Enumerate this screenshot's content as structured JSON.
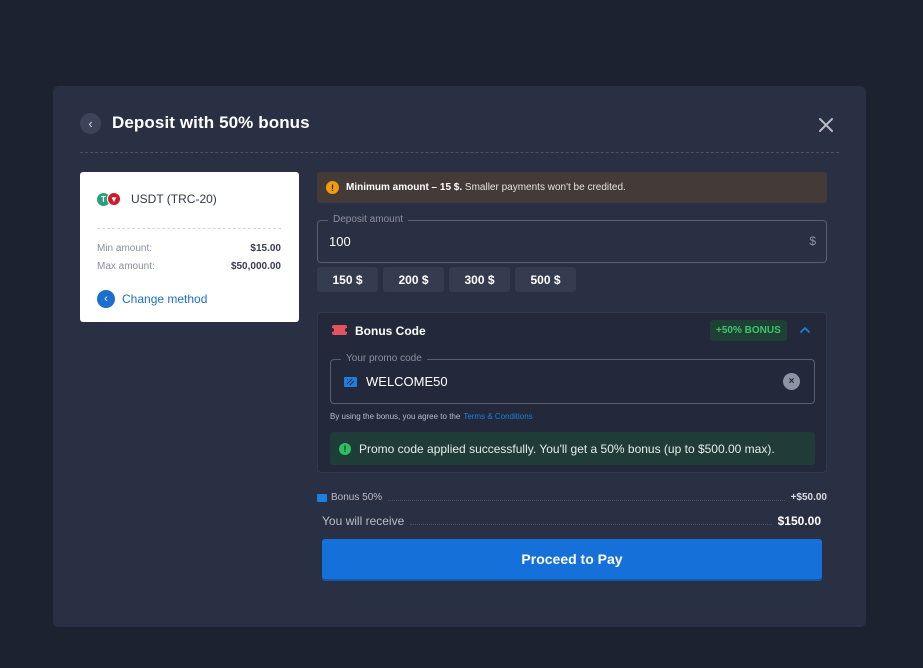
{
  "modal": {
    "title": "Deposit with 50% bonus",
    "back_icon": "chevron-left-icon",
    "close_icon": "close-icon"
  },
  "method": {
    "name": "USDT (TRC-20)",
    "coin_icons": [
      "usdt-icon",
      "tron-icon"
    ],
    "min_label": "Min amount:",
    "min_value": "$15.00",
    "max_label": "Max amount:",
    "max_value": "$50,000.00",
    "change_label": "Change method"
  },
  "warning": {
    "bold": "Minimum amount – 15 $.",
    "rest": " Smaller payments won't be credited."
  },
  "deposit": {
    "legend": "Deposit amount",
    "value": "100",
    "currency": "$",
    "quick_amounts": [
      "150 $",
      "200 $",
      "300 $",
      "500 $"
    ]
  },
  "bonus": {
    "title": "Bonus Code",
    "badge": "+50% BONUS",
    "promo_legend": "Your promo code",
    "promo_value": "WELCOME50",
    "terms_text": "By using the bonus, you agree to the",
    "terms_link": "Terms & Conditions",
    "success_text": "Promo code applied successfully. You'll get a 50% bonus (up to $500.00 max)."
  },
  "summary": {
    "bonus_label": "Bonus 50%",
    "bonus_value": "+$50.00",
    "receive_label": "You will receive",
    "receive_value": "$150.00"
  },
  "actions": {
    "proceed_label": "Proceed to Pay"
  },
  "colors": {
    "background": "#1d2231",
    "modal": "#2a3043",
    "accent": "#1670d9",
    "success": "#2fbf63",
    "warning": "#f29b0c"
  }
}
